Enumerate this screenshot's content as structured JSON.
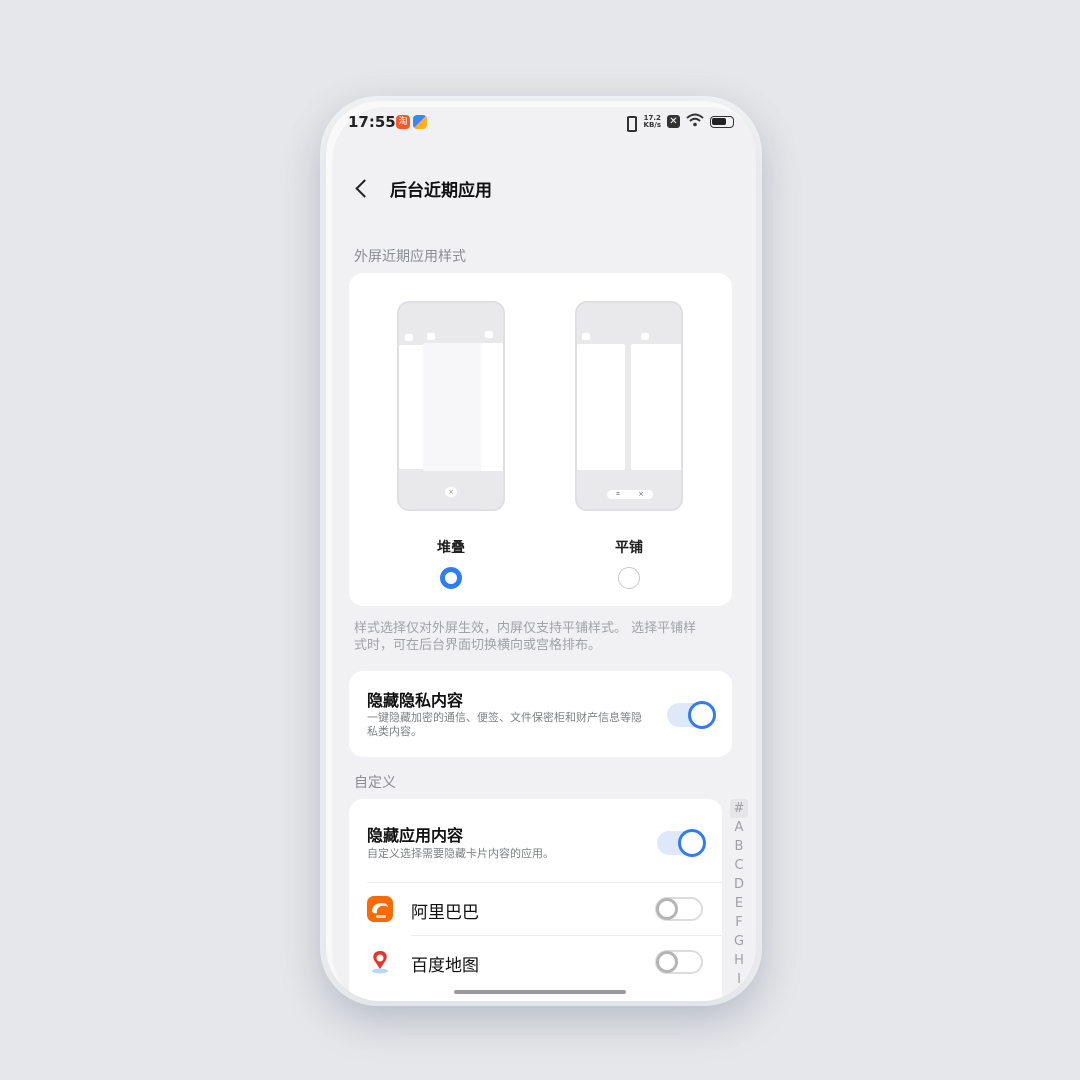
{
  "status_bar": {
    "time": "17:55",
    "app1_glyph": "淘",
    "net_speed_value": "17.2",
    "net_speed_unit": "KB/s",
    "icons": [
      "vibrate-icon",
      "network-speed",
      "nfc-icon",
      "wifi-icon",
      "battery-icon"
    ]
  },
  "header": {
    "title": "后台近期应用"
  },
  "style_section": {
    "label": "外屏近期应用样式",
    "options": [
      {
        "label": "堆叠",
        "selected": true
      },
      {
        "label": "平铺",
        "selected": false
      }
    ],
    "tile_dock_glyphs": [
      "⌗",
      "×"
    ],
    "stack_close_glyph": "×",
    "note": "样式选择仅对外屏生效，内屏仅支持平铺样式。 选择平铺样式时，可在后台界面切换横向或宫格排布。"
  },
  "privacy": {
    "title": "隐藏隐私内容",
    "desc": "一键隐藏加密的通信、便签、文件保密柜和财产信息等隐私类内容。",
    "enabled": true
  },
  "custom": {
    "label": "自定义",
    "hide_app": {
      "title": "隐藏应用内容",
      "desc": "自定义选择需要隐藏卡片内容的应用。",
      "enabled": true
    },
    "apps": [
      {
        "name": "阿里巴巴",
        "enabled": false,
        "color": "#ff6a00"
      },
      {
        "name": "百度地图",
        "enabled": false,
        "color": "#e8352b"
      }
    ]
  },
  "index": [
    "#",
    "A",
    "B",
    "C",
    "D",
    "E",
    "F",
    "G",
    "H",
    "I"
  ],
  "colors": {
    "accent": "#2f7df6",
    "background": "#f1f1f3",
    "card": "#ffffff"
  }
}
